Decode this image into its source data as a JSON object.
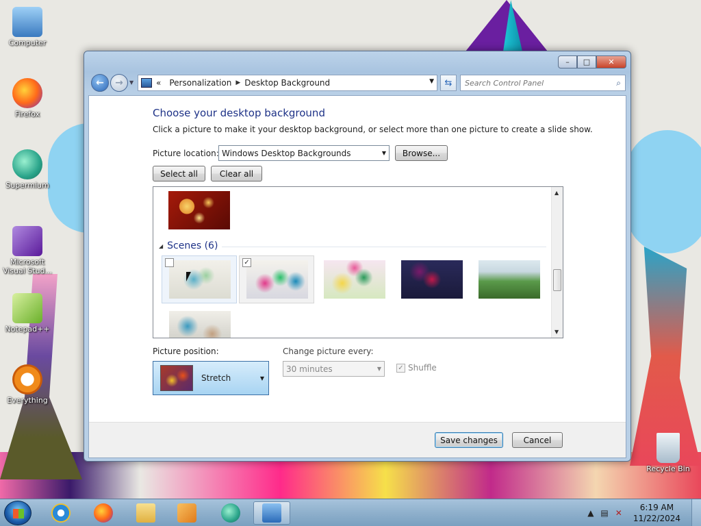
{
  "desktop": {
    "icons": [
      {
        "label": "Computer",
        "icon": "computer-icon",
        "color": "#5a9ad8"
      },
      {
        "label": "Firefox",
        "icon": "firefox-icon",
        "color": "#ff7a1a"
      },
      {
        "label": "Supermium",
        "icon": "supermium-icon",
        "color": "#2aa48a"
      },
      {
        "label": "Microsoft Visual Stud...",
        "icon": "visual-studio-icon",
        "color": "#7a3ab8"
      },
      {
        "label": "Notepad++",
        "icon": "notepadpp-icon",
        "color": "#8ac04a"
      },
      {
        "label": "Everything",
        "icon": "everything-icon",
        "color": "#f08a1a"
      }
    ],
    "recycle_bin": {
      "label": "Recycle Bin",
      "icon": "recycle-bin-icon"
    }
  },
  "window": {
    "controls": {
      "minimize": "–",
      "maximize": "□",
      "close": "✕"
    },
    "nav": {
      "back": "←",
      "forward": "→",
      "breadcrumb_prefix": "«",
      "breadcrumb": [
        "Personalization",
        "Desktop Background"
      ],
      "separator": "▶",
      "search_placeholder": "Search Control Panel"
    },
    "heading": "Choose your desktop background",
    "subtext": "Click a picture to make it your desktop background, or select more than one picture to create a slide show.",
    "picture_location_label": "Picture location:",
    "picture_location_value": "Windows Desktop Backgrounds",
    "browse_label": "Browse...",
    "select_all_label": "Select all",
    "clear_all_label": "Clear all",
    "group": {
      "name": "Scenes (6)"
    },
    "tiles": [
      {
        "checked": false,
        "mark": ""
      },
      {
        "checked": true,
        "mark": "✓"
      },
      {
        "checked": false,
        "mark": ""
      },
      {
        "checked": false,
        "mark": ""
      },
      {
        "checked": false,
        "mark": ""
      },
      {
        "checked": false,
        "mark": ""
      }
    ],
    "picture_position_label": "Picture position:",
    "picture_position_value": "Stretch",
    "change_every_label": "Change picture every:",
    "change_every_value": "30 minutes",
    "shuffle_label": "Shuffle",
    "shuffle_checked": true,
    "save_label": "Save changes",
    "cancel_label": "Cancel"
  },
  "taskbar": {
    "items": [
      "internet-explorer-icon",
      "firefox-icon",
      "file-explorer-icon",
      "media-player-icon",
      "supermium-icon",
      "control-panel-icon"
    ],
    "tray_arrow": "▲",
    "time": "6:19 AM",
    "date": "11/22/2024"
  }
}
